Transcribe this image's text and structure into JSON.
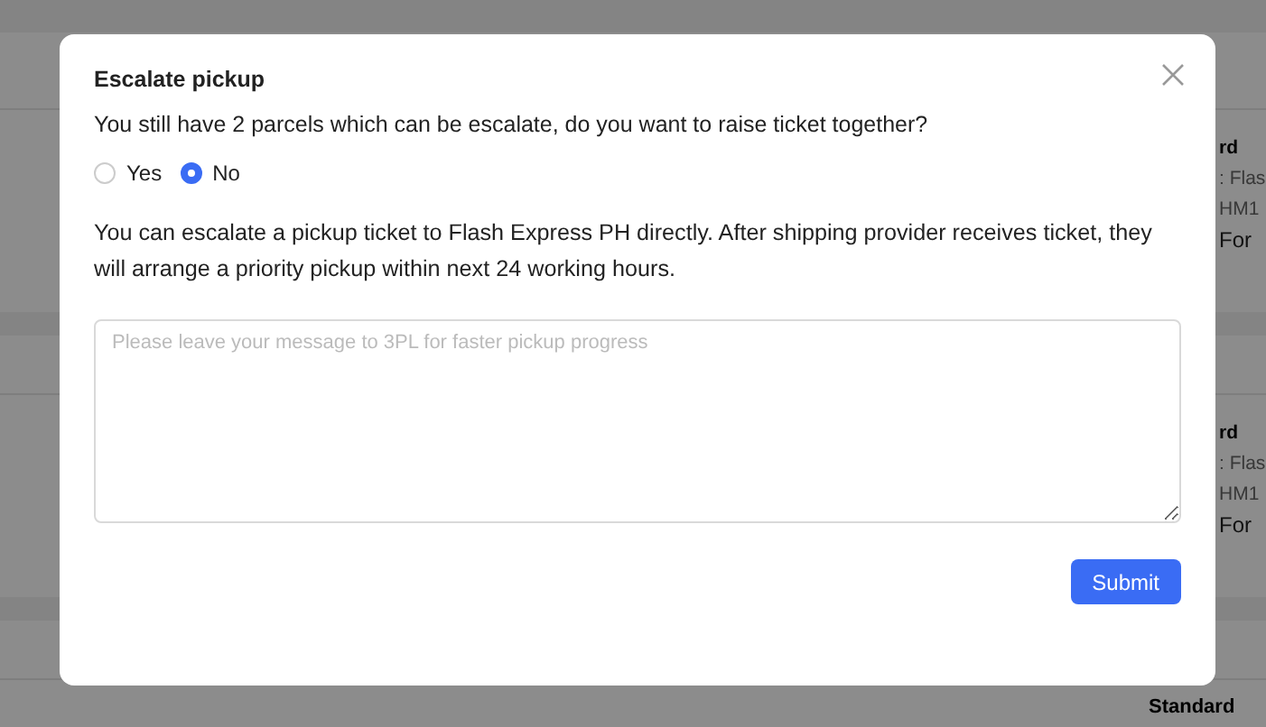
{
  "background": {
    "rows": [
      {
        "lines": [
          "rd",
          ": Flas",
          "HM1",
          "For"
        ]
      },
      {
        "lines": [
          "rd",
          ": Flas",
          "HM1",
          "For"
        ]
      },
      {
        "lines": [
          "Standard"
        ]
      }
    ]
  },
  "modal": {
    "title": "Escalate pickup",
    "question": "You still have 2 parcels which can be escalate, do you want to raise ticket together?",
    "options": [
      {
        "label": "Yes",
        "selected": false
      },
      {
        "label": "No",
        "selected": true
      }
    ],
    "description": "You can escalate a pickup ticket to Flash Express PH directly. After shipping provider receives ticket, they will arrange a priority pickup within next 24 working hours.",
    "message": {
      "placeholder": "Please leave your message to 3PL for faster pickup progress"
    },
    "buttons": [
      {
        "label": "Submit"
      }
    ]
  }
}
